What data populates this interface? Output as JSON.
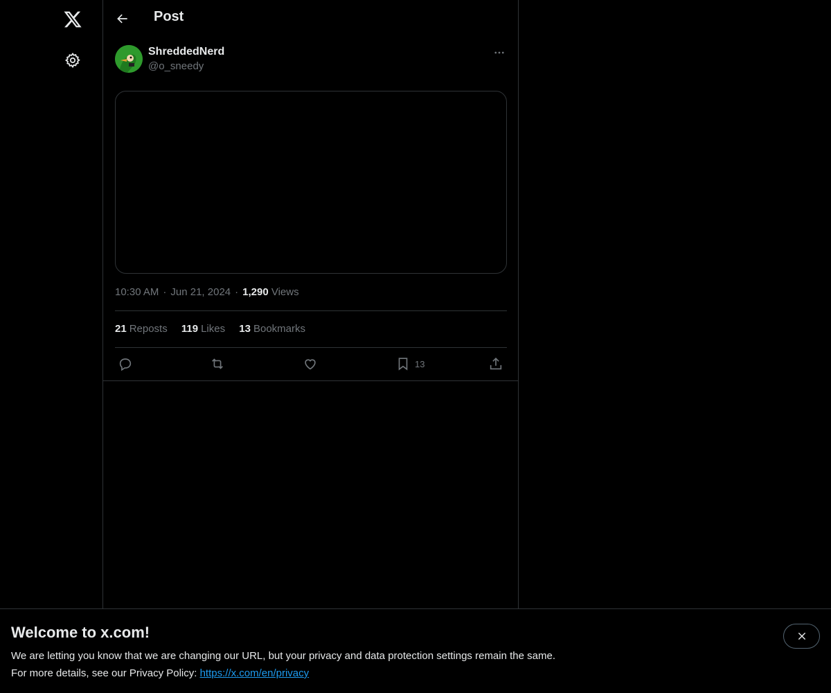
{
  "header": {
    "title": "Post"
  },
  "post": {
    "author_name": "ShreddedNerd",
    "author_handle": "@o_sneedy",
    "time": "10:30 AM",
    "date": "Jun 21, 2024",
    "separator": "·",
    "views_count": "1,290",
    "views_label": "Views",
    "reposts_count": "21",
    "reposts_label": "Reposts",
    "likes_count": "119",
    "likes_label": "Likes",
    "bookmarks_count": "13",
    "bookmarks_label": "Bookmarks",
    "bookmark_action_count": "13"
  },
  "banner": {
    "title": "Welcome to x.com!",
    "line1": "We are letting you know that we are changing our URL, but your privacy and data protection settings remain the same.",
    "line2_prefix": "For more details, see our Privacy Policy: ",
    "link": "https://x.com/en/privacy"
  },
  "icons": {
    "logo": "x-logo-icon",
    "settings": "gear-icon",
    "back": "arrow-left-icon",
    "more": "more-horizontal-icon",
    "reply": "reply-icon",
    "repost": "repost-icon",
    "like": "heart-icon",
    "bookmark": "bookmark-icon",
    "share": "share-icon",
    "close": "close-icon"
  },
  "colors": {
    "background": "#000000",
    "text": "#e7e9ea",
    "muted": "#71767b",
    "border": "#2f3336",
    "link": "#1d9bf0"
  }
}
